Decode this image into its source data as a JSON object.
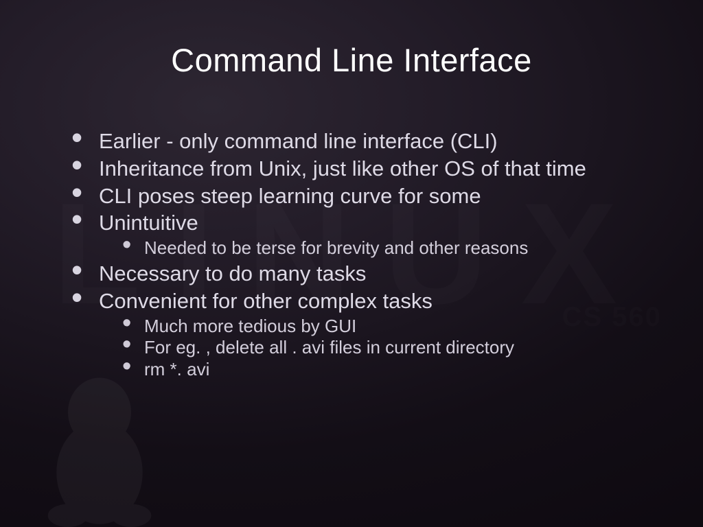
{
  "title": "Command Line Interface",
  "watermark_large": "LINUX",
  "watermark_small": "CS 560",
  "bullets": {
    "b1": "Earlier - only command line interface (CLI)",
    "b2": "Inheritance from Unix, just like other OS of that time",
    "b3": "CLI poses steep learning curve for some",
    "b4": "Unintuitive",
    "b4_1": "Needed to be terse for brevity and other reasons",
    "b5": "Necessary to do many tasks",
    "b6": "Convenient for other complex tasks",
    "b6_1": "Much more tedious by GUI",
    "b6_2": "For eg. , delete all . avi files in current directory",
    "b6_3": "rm *. avi"
  }
}
